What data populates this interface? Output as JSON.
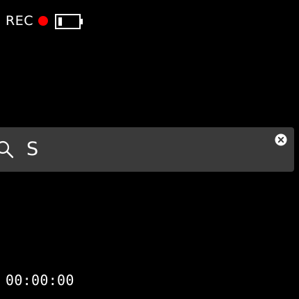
{
  "recording": {
    "label": "REC",
    "dot_icon": "record-dot-icon",
    "dot_color": "#ff0000"
  },
  "battery": {
    "icon": "battery-low-icon",
    "level": 0.15
  },
  "search": {
    "icon": "search-icon",
    "value": "S",
    "clear_icon": "close-circle-icon"
  },
  "timecode": "00:00:00",
  "colors": {
    "background": "#000000",
    "search_bar": "#3a3a3a",
    "text": "#ffffff"
  }
}
